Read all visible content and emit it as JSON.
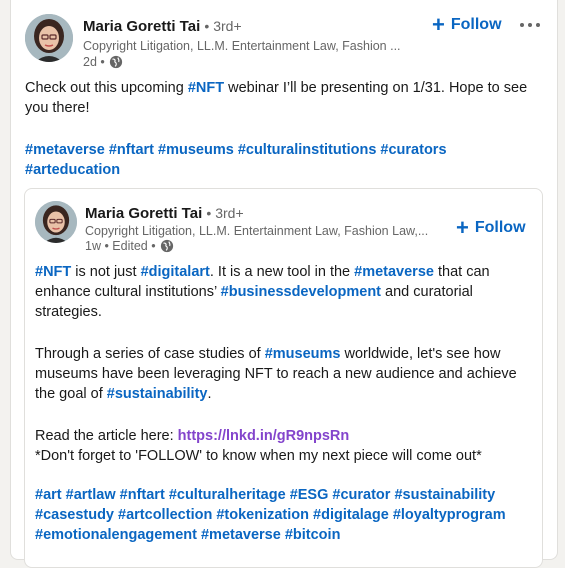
{
  "post": {
    "author": {
      "name": "Maria Goretti Tai",
      "degree": "• 3rd+",
      "headline": "Copyright Litigation, LL.M. Entertainment Law, Fashion ...",
      "time": "2d •"
    },
    "follow_label": "Follow",
    "text": {
      "before_tag": "Check out this upcoming ",
      "tag": "#NFT",
      "after_tag": " webinar I’ll be presenting on 1/31. Hope to see you there!"
    },
    "hashtags": [
      "#metaverse",
      "#nftart",
      "#museums",
      "#culturalinstitutions",
      "#curators",
      "#arteducation"
    ]
  },
  "shared": {
    "author": {
      "name": "Maria Goretti Tai",
      "degree": "• 3rd+",
      "headline": "Copyright Litigation, LL.M. Entertainment Law, Fashion Law,...",
      "time": "1w • Edited •"
    },
    "follow_label": "Follow",
    "p1": {
      "t1": "#NFT",
      "s1": " is not just ",
      "t2": "#digitalart",
      "s2": ". It is a new tool in the ",
      "t3": "#metaverse",
      "s3": " that can enhance cultural institutions’ ",
      "t4": "#businessdevelopment",
      "s4": " and curatorial strategies."
    },
    "p2": {
      "s1": "Through a series of case studies of ",
      "t1": "#museums",
      "s2": " worldwide, let's see how museums have been leveraging NFT to reach a new audience and achieve the goal of ",
      "t2": "#sustainability",
      "s3": "."
    },
    "p3": {
      "s1": "Read the article here: ",
      "link": "https://lnkd.in/gR9npsRn",
      "line2": "*Don't forget to 'FOLLOW' to know when my next piece will come out*"
    },
    "hashtags": [
      "#art",
      "#artlaw",
      "#nftart",
      "#culturalheritage",
      "#ESG",
      "#curator",
      "#sustainability",
      "#casestudy",
      "#artcollection",
      "#tokenization",
      "#digitalage",
      "#loyaltyprogram",
      "#emotionalengagement",
      "#metaverse",
      "#bitcoin"
    ]
  }
}
